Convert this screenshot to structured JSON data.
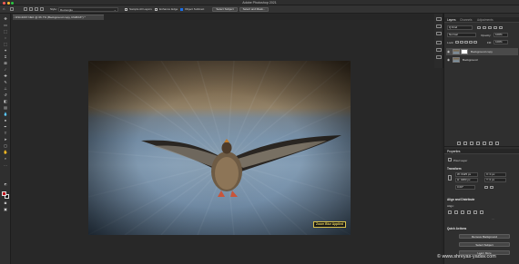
{
  "window": {
    "title": "Adobe Photoshop 2021"
  },
  "options_bar": {
    "style_label": "Style:",
    "style_value": "Rectangle",
    "sample_all_layers": "Sample All Layers",
    "enhance_edge": "Enhance Edge",
    "object_subtract": "Object Subtract",
    "select_subject": "Select Subject",
    "select_and_mask": "Select and Mask..."
  },
  "document_tab": {
    "label": "DSC4097.NEF @ 66.7% (Background copy, RGB/16*) *"
  },
  "canvas": {
    "overlay_label": "Zoom Blur Applied"
  },
  "panels": {
    "tabs": [
      "Layers",
      "Channels",
      "Adjustments"
    ],
    "kind_filter": "Q Kind",
    "blend_mode": "Normal",
    "opacity_label": "Opacity:",
    "opacity_value": "100%",
    "lock_label": "Lock:",
    "fill_label": "Fill:",
    "fill_value": "100%",
    "layers": [
      {
        "name": "Background copy",
        "selected": true
      },
      {
        "name": "Background",
        "selected": false
      }
    ]
  },
  "properties": {
    "header": "Properties",
    "pixel_layer": "Pixel Layer",
    "transform_header": "Transform",
    "w_value": "W: 6425 px",
    "h_value": "H: 4283 px",
    "x_value": "X: 0 px",
    "y_value": "Y: 0 px",
    "angle_value": "0.00°",
    "align_header": "Align and Distribute",
    "align_label": "Align:",
    "quick_actions_header": "Quick Actions",
    "remove_background": "Remove Background",
    "select_subject": "Select Subject",
    "learn_more": "Learn More"
  },
  "watermark": "© www.shreyas-yadav.com",
  "colors": {
    "foreground_swatch": "#c0131a",
    "background_swatch": "#1a1a1a",
    "label_border": "#d8c14a"
  }
}
